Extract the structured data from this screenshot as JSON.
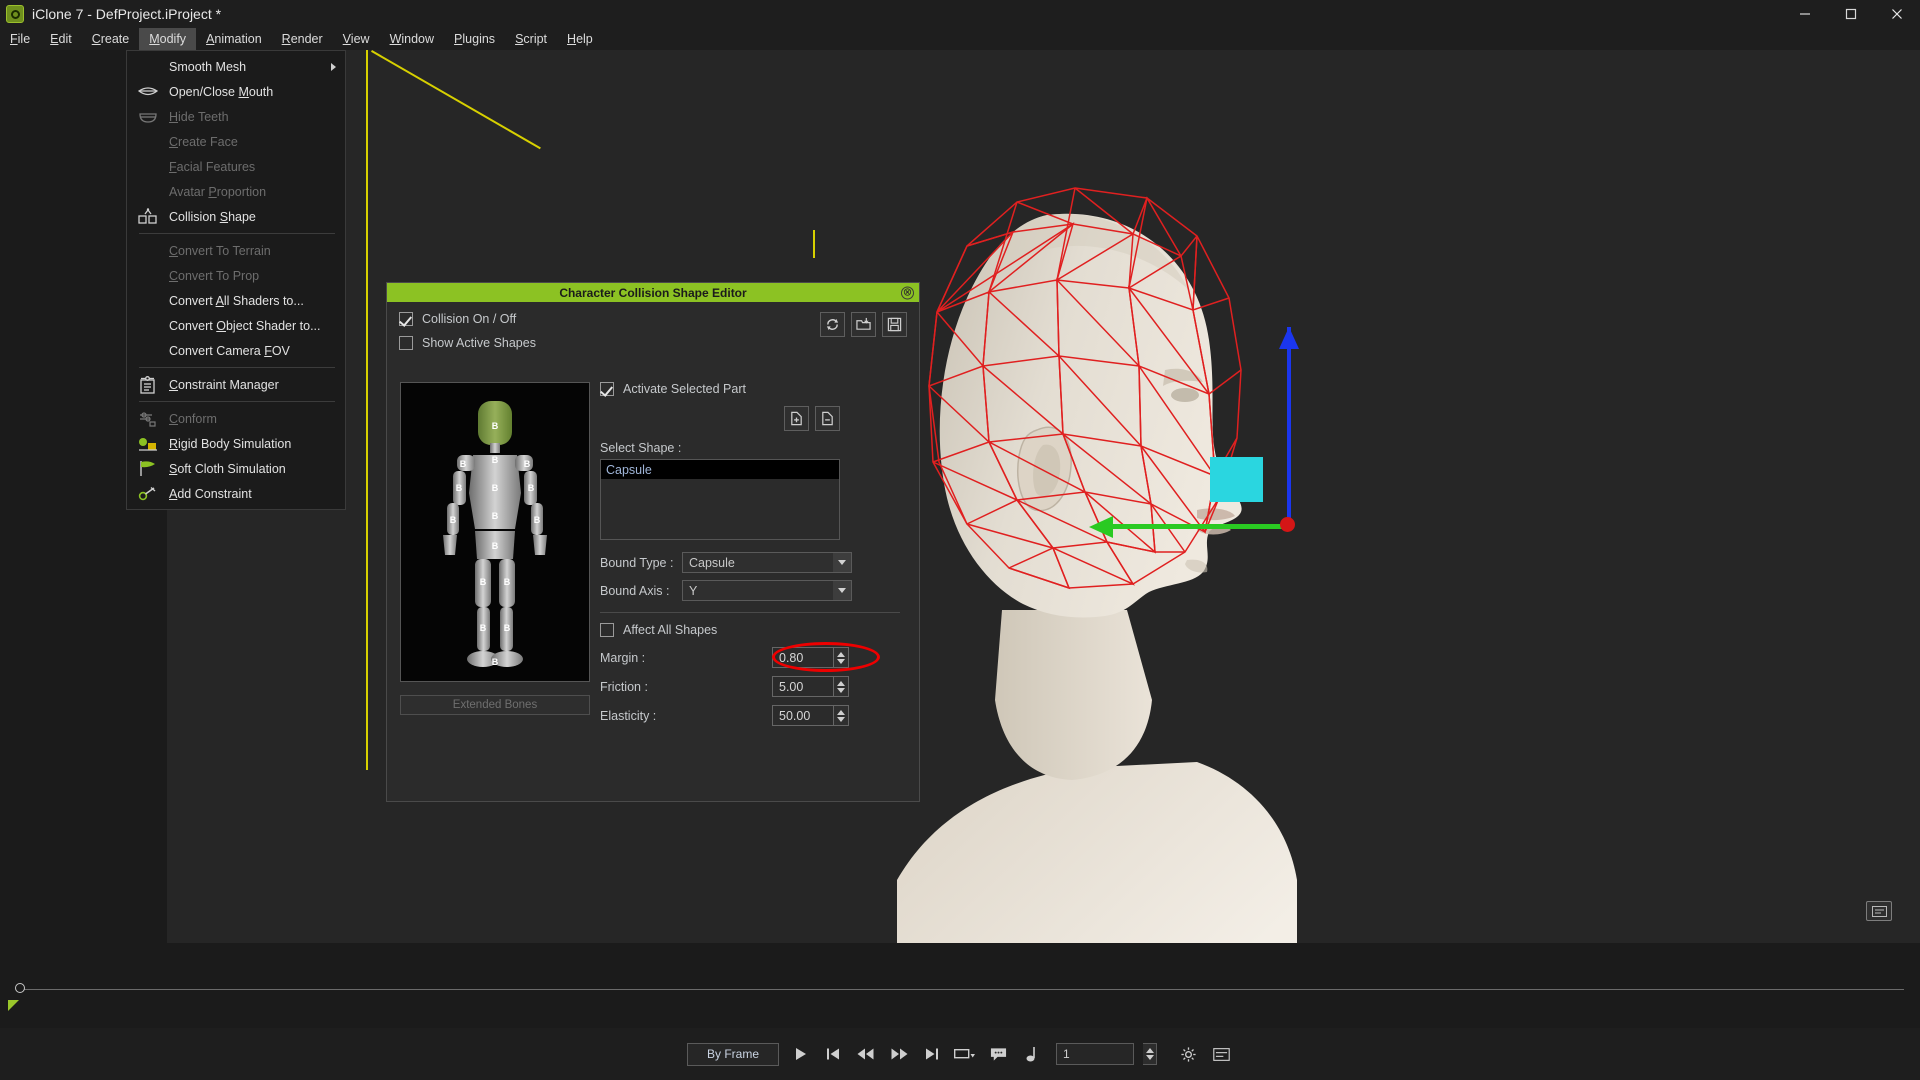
{
  "titlebar": {
    "title": "iClone 7 - DefProject.iProject *",
    "logo_icon": "iclone-logo-icon",
    "minimize_label": "Minimize",
    "maximize_label": "Maximize",
    "close_label": "Close"
  },
  "menubar": {
    "items": [
      {
        "label": "File",
        "mnemonic": "F",
        "active": false
      },
      {
        "label": "Edit",
        "mnemonic": "E",
        "active": false
      },
      {
        "label": "Create",
        "mnemonic": "C",
        "active": false
      },
      {
        "label": "Modify",
        "mnemonic": "M",
        "active": true
      },
      {
        "label": "Animation",
        "mnemonic": "A",
        "active": false
      },
      {
        "label": "Render",
        "mnemonic": "R",
        "active": false
      },
      {
        "label": "View",
        "mnemonic": "V",
        "active": false
      },
      {
        "label": "Window",
        "mnemonic": "W",
        "active": false
      },
      {
        "label": "Plugins",
        "mnemonic": "P",
        "active": false
      },
      {
        "label": "Script",
        "mnemonic": "S",
        "active": false
      },
      {
        "label": "Help",
        "mnemonic": "H",
        "active": false
      }
    ]
  },
  "modify_menu": {
    "items": [
      {
        "label": "Smooth Mesh",
        "icon": "none",
        "disabled": false,
        "submenu": true
      },
      {
        "label": "Open/Close Mouth",
        "icon": "mouth-icon",
        "disabled": false,
        "submenu": false
      },
      {
        "label": "Hide Teeth",
        "icon": "teeth-icon",
        "disabled": true,
        "submenu": false
      },
      {
        "label": "Create Face",
        "icon": "none",
        "disabled": true,
        "submenu": false
      },
      {
        "label": "Facial Features",
        "icon": "none",
        "disabled": true,
        "submenu": false
      },
      {
        "label": "Avatar Proportion",
        "icon": "none",
        "disabled": true,
        "submenu": false
      },
      {
        "label": "Collision Shape",
        "icon": "collision-shape-icon",
        "disabled": false,
        "submenu": false
      },
      {
        "separator": true
      },
      {
        "label": "Convert To Terrain",
        "icon": "none",
        "disabled": true,
        "submenu": false
      },
      {
        "label": "Convert To Prop",
        "icon": "none",
        "disabled": true,
        "submenu": false
      },
      {
        "label": "Convert All Shaders to...",
        "icon": "none",
        "disabled": false,
        "submenu": false
      },
      {
        "label": "Convert Object Shader to...",
        "icon": "none",
        "disabled": false,
        "submenu": false
      },
      {
        "label": "Convert Camera FOV",
        "icon": "none",
        "disabled": false,
        "submenu": false
      },
      {
        "separator": true
      },
      {
        "label": "Constraint Manager",
        "icon": "constraint-manager-icon",
        "disabled": false,
        "submenu": false
      },
      {
        "separator": true
      },
      {
        "label": "Conform",
        "icon": "conform-icon",
        "disabled": true,
        "submenu": false
      },
      {
        "label": "Rigid Body Simulation",
        "icon": "rigid-body-icon",
        "disabled": false,
        "submenu": false
      },
      {
        "label": "Soft Cloth Simulation",
        "icon": "soft-cloth-icon",
        "disabled": false,
        "submenu": false
      },
      {
        "label": "Add Constraint",
        "icon": "add-constraint-icon",
        "disabled": false,
        "submenu": false
      }
    ]
  },
  "dialog": {
    "title": "Character Collision Shape Editor",
    "close_label": "⊗",
    "collision_toggle": {
      "label": "Collision On / Off",
      "checked": true
    },
    "show_active_shapes": {
      "label": "Show Active Shapes",
      "checked": false
    },
    "toolbar": [
      {
        "name": "reset-icon",
        "tooltip": "Reset"
      },
      {
        "name": "load-icon",
        "tooltip": "Load"
      },
      {
        "name": "save-icon",
        "tooltip": "Save"
      }
    ],
    "extended_bones_label": "Extended Bones",
    "activate_selected_part": {
      "label": "Activate Selected Part",
      "checked": true
    },
    "shape_tools": [
      {
        "name": "add-shape-icon",
        "tooltip": "Add Shape"
      },
      {
        "name": "remove-shape-icon",
        "tooltip": "Remove Shape"
      }
    ],
    "select_shape_label": "Select Shape :",
    "shape_list": [
      "Capsule"
    ],
    "selected_shape": "Capsule",
    "bound_type_label": "Bound Type :",
    "bound_type_value": "Capsule",
    "bound_axis_label": "Bound Axis :",
    "bound_axis_value": "Y",
    "affect_all_shapes": {
      "label": "Affect All Shapes",
      "checked": false
    },
    "margin_label": "Margin :",
    "margin_value": "0.80",
    "friction_label": "Friction :",
    "friction_value": "5.00",
    "elasticity_label": "Elasticity :",
    "elasticity_value": "50.00",
    "highlight_color": "#ee0000",
    "accent_color": "#8cc223"
  },
  "viewport": {
    "wireframe_color": "#e02020",
    "guide_color": "#d7d000",
    "gizmo": {
      "x_axis_color": "#2aca22",
      "y_axis_color": "#1b36ee",
      "origin_color": "#d41616",
      "selection_box_color": "#2ad6e0"
    },
    "corner_button_icon": "viewport-notes-icon",
    "preview_bone_label": "B"
  },
  "timeline": {
    "playhead_position": "0"
  },
  "transport": {
    "mode_label": "By Frame",
    "buttons": [
      {
        "name": "play-button",
        "glyph": "▶"
      },
      {
        "name": "prev-key-button",
        "glyph": "⏮"
      },
      {
        "name": "rewind-button",
        "glyph": "⏪"
      },
      {
        "name": "fast-forward-button",
        "glyph": "⏩"
      },
      {
        "name": "next-key-button",
        "glyph": "⏭"
      },
      {
        "name": "loop-range-button",
        "glyph": "▭"
      },
      {
        "name": "comment-button",
        "glyph": "⌨"
      },
      {
        "name": "audio-button",
        "glyph": "♪"
      }
    ],
    "frame_value": "1"
  }
}
